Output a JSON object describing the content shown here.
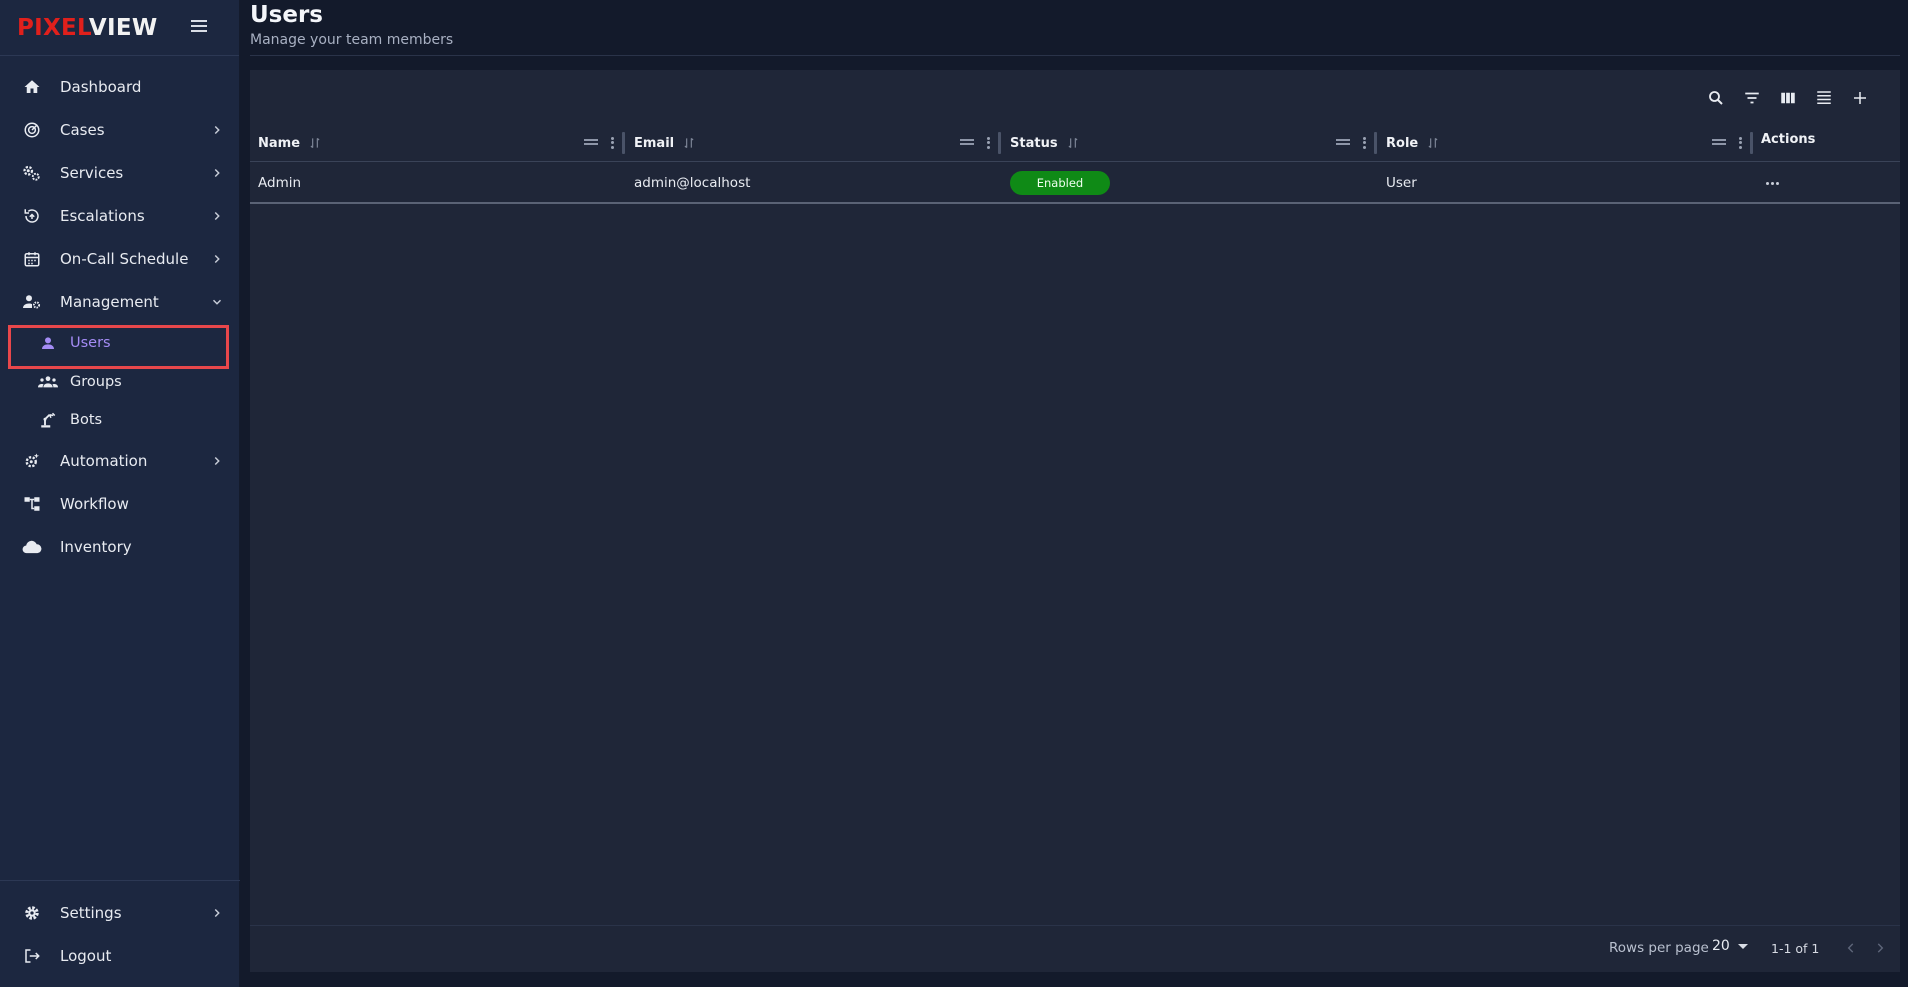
{
  "brand": {
    "part1": "PIXEL",
    "part2": "VIEW"
  },
  "sidebar": {
    "items": [
      {
        "label": "Dashboard",
        "icon": "home-icon"
      },
      {
        "label": "Cases",
        "icon": "radar-icon"
      },
      {
        "label": "Services",
        "icon": "gears-icon"
      },
      {
        "label": "Escalations",
        "icon": "escalation-icon"
      },
      {
        "label": "On-Call Schedule",
        "icon": "calendar-icon"
      },
      {
        "label": "Management",
        "icon": "user-gear-icon"
      },
      {
        "label": "Automation",
        "icon": "automation-gear-icon"
      },
      {
        "label": "Workflow",
        "icon": "workflow-icon"
      },
      {
        "label": "Inventory",
        "icon": "cloud-icon"
      }
    ],
    "sub_items": [
      {
        "label": "Users",
        "icon": "person-icon",
        "active": true
      },
      {
        "label": "Groups",
        "icon": "groups-icon"
      },
      {
        "label": "Bots",
        "icon": "robot-arm-icon"
      }
    ],
    "bottom": [
      {
        "label": "Settings",
        "icon": "settings-gear-icon"
      },
      {
        "label": "Logout",
        "icon": "logout-icon"
      }
    ]
  },
  "header": {
    "title": "Users",
    "subtitle": "Manage your team members"
  },
  "table": {
    "columns": [
      "Name",
      "Email",
      "Status",
      "Role",
      "Actions"
    ],
    "rows": [
      {
        "name": "Admin",
        "email": "admin@localhost",
        "status": "Enabled",
        "role": "User"
      }
    ]
  },
  "pagination": {
    "rows_per_page_label": "Rows per page",
    "rows_per_page": "20",
    "range": "1-1 of 1"
  },
  "colors": {
    "accent": "#a48cf5",
    "status_enabled": "#0f8a16",
    "brand_red": "#e0201c",
    "highlight": "#e8474b"
  }
}
